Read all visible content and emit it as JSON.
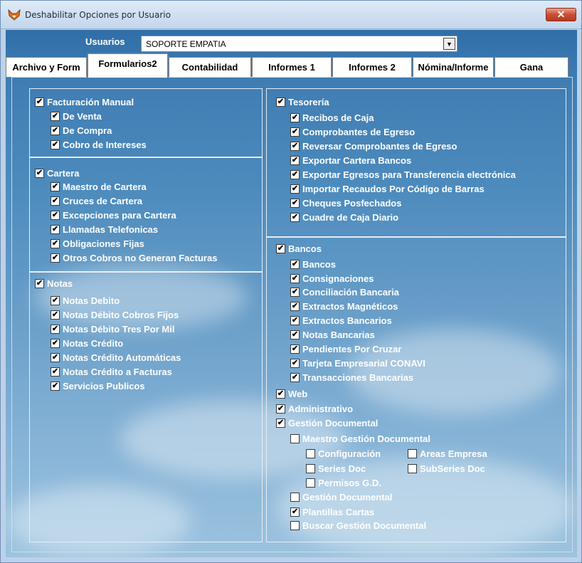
{
  "window": {
    "title": "Deshabilitar Opciones por Usuario",
    "close_glyph": "✕"
  },
  "usuarios": {
    "label": "Usuarios",
    "value": "SOPORTE EMPATIA",
    "dropdown_glyph": "▼"
  },
  "tabs": [
    "Archivo y Form",
    "Formularios2",
    "Contabilidad",
    "Informes 1",
    "Informes 2",
    "Nómina/Informe",
    "Gana"
  ],
  "active_tab": "Formularios2",
  "icons": {
    "app": "fox-icon",
    "close": "close-icon",
    "dropdown": "chevron-down-icon"
  },
  "colors": {
    "check_mark": "#000000",
    "label_text": "#ffffff",
    "close_button": "#c94f34"
  },
  "check_mark": "✔",
  "groups": {
    "facturacion": {
      "title": "Facturación Manual",
      "checked": true,
      "items": [
        {
          "label": "De Venta",
          "checked": true
        },
        {
          "label": "De Compra",
          "checked": true
        },
        {
          "label": "Cobro de Intereses",
          "checked": true
        }
      ]
    },
    "cartera": {
      "title": "Cartera",
      "checked": true,
      "items": [
        {
          "label": "Maestro de Cartera",
          "checked": true
        },
        {
          "label": "Cruces de Cartera",
          "checked": true
        },
        {
          "label": "Excepciones para Cartera",
          "checked": true
        },
        {
          "label": "Llamadas Telefonicas",
          "checked": true
        },
        {
          "label": "Obligaciones Fijas",
          "checked": true
        },
        {
          "label": "Otros Cobros no Generan Facturas",
          "checked": true
        }
      ]
    },
    "notas": {
      "title": "Notas",
      "checked": true,
      "items": [
        {
          "label": "Notas Debito",
          "checked": true
        },
        {
          "label": "Notas Débito Cobros Fijos",
          "checked": true
        },
        {
          "label": "Notas Débito Tres Por Mil",
          "checked": true
        },
        {
          "label": "Notas Crédito",
          "checked": true
        },
        {
          "label": "Notas Crédito Automáticas",
          "checked": true
        },
        {
          "label": "Notas Crédito a Facturas",
          "checked": true
        },
        {
          "label": "Servicios Publicos",
          "checked": true
        }
      ]
    },
    "tesoreria": {
      "title": "Tesorería",
      "checked": true,
      "items": [
        {
          "label": "Recibos de Caja",
          "checked": true
        },
        {
          "label": "Comprobantes de Egreso",
          "checked": true
        },
        {
          "label": "Reversar Comprobantes de Egreso",
          "checked": true
        },
        {
          "label": "Exportar Cartera Bancos",
          "checked": true
        },
        {
          "label": "Exportar Egresos para Transferencia electrónica",
          "checked": true
        },
        {
          "label": "Importar Recaudos Por Código de Barras",
          "checked": true
        },
        {
          "label": "Cheques Posfechados",
          "checked": true
        },
        {
          "label": "Cuadre de Caja Diario",
          "checked": true
        }
      ]
    },
    "bancos": {
      "title": "Bancos",
      "checked": true,
      "items": [
        {
          "label": "Bancos",
          "checked": true
        },
        {
          "label": "Consignaciones",
          "checked": true
        },
        {
          "label": "Conciliación Bancaria",
          "checked": true
        },
        {
          "label": "Extractos Magnéticos",
          "checked": true
        },
        {
          "label": "Extractos Bancarios",
          "checked": true
        },
        {
          "label": "Notas Bancarias",
          "checked": true
        },
        {
          "label": "Pendientes Por Cruzar",
          "checked": true
        },
        {
          "label": "Tarjeta Empresarial CONAVI",
          "checked": true
        },
        {
          "label": "Transacciones Bancarias",
          "checked": true
        }
      ]
    },
    "web": {
      "label": "Web",
      "checked": true
    },
    "administrativo": {
      "label": "Administrativo",
      "checked": true
    },
    "gestion": {
      "title": "Gestión Documental",
      "checked": true,
      "maestro": {
        "label": "Maestro Gestión Documental",
        "checked": false
      },
      "configuracion": {
        "label": "Configuración",
        "checked": false
      },
      "areas_empresa": {
        "label": "Areas Empresa",
        "checked": false
      },
      "series_doc": {
        "label": "Series Doc",
        "checked": false
      },
      "subseries_doc": {
        "label": "SubSeries Doc",
        "checked": false
      },
      "permisos": {
        "label": "Permisos G.D.",
        "checked": false
      },
      "gestion_documental": {
        "label": "Gestión Documental",
        "checked": false
      },
      "plantillas": {
        "label": "Plantillas Cartas",
        "checked": true
      },
      "buscar": {
        "label": "Buscar Gestión Documental",
        "checked": false
      }
    }
  }
}
